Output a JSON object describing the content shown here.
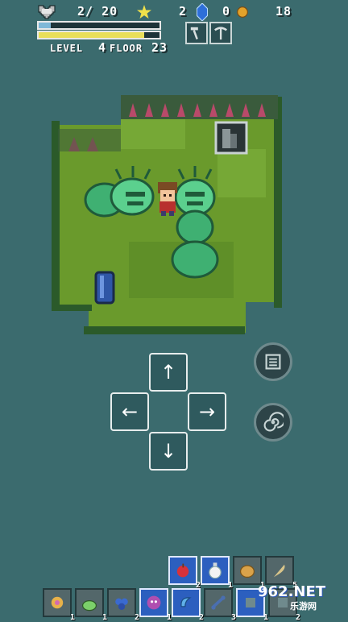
{
  "hud": {
    "hp_text": "2/ 20",
    "stars": "2",
    "gems": "0",
    "coins": "18",
    "level_label": "LEVEL",
    "level_value": "4",
    "floor_label": "FLOOR",
    "floor_value": "23",
    "hp_fraction": 0.1,
    "xp_fraction": 0.87,
    "colors": {
      "hp": "#7fb8d8",
      "xp": "#e9df5a"
    }
  },
  "tools": [
    "hammer-icon",
    "pickaxe-icon"
  ],
  "dpad": {
    "up": "↑",
    "left": "←",
    "right": "→",
    "down": "↓"
  },
  "inventory": {
    "top_row": [
      {
        "icon": "apple-icon",
        "count": "2",
        "selected": true
      },
      {
        "icon": "potion-icon",
        "count": "1",
        "selected": true
      },
      {
        "icon": "bread-icon",
        "count": "1",
        "selected": false
      },
      {
        "icon": "feather-icon",
        "count": "5",
        "selected": false
      }
    ],
    "bottom_row": [
      {
        "icon": "flower-icon",
        "count": "1",
        "selected": false
      },
      {
        "icon": "slime-icon",
        "count": "1",
        "selected": false
      },
      {
        "icon": "berries-icon",
        "count": "2",
        "selected": false
      },
      {
        "icon": "skull-orb-icon",
        "count": "1",
        "selected": true
      },
      {
        "icon": "blue-bean-icon",
        "count": "2",
        "selected": true
      },
      {
        "icon": "bones-icon",
        "count": "3",
        "selected": false
      },
      {
        "icon": "unknown-icon",
        "count": "1",
        "selected": true
      },
      {
        "icon": "unknown-icon",
        "count": "2",
        "selected": false
      }
    ]
  },
  "watermark": {
    "brand": "962.NET",
    "sub": "乐游网"
  }
}
